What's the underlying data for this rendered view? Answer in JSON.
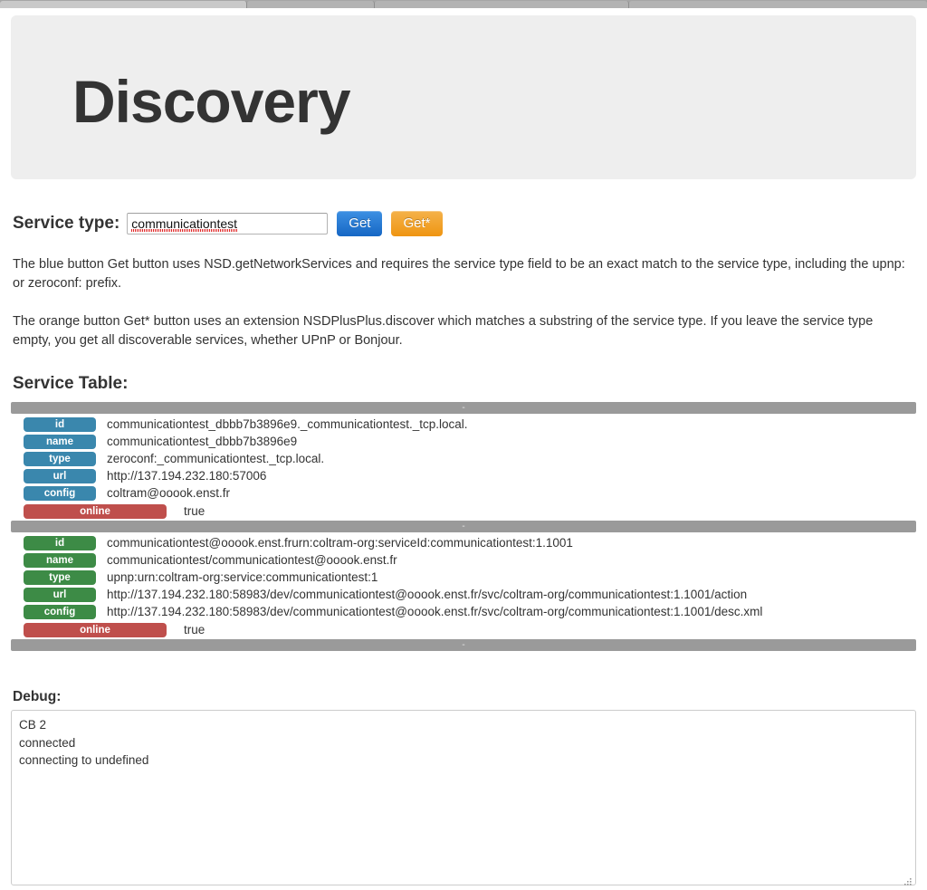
{
  "browser": {
    "tabs": [
      {
        "name": "tab-1",
        "active": true
      },
      {
        "name": "tab-2",
        "active": false
      },
      {
        "name": "tab-3",
        "active": false
      },
      {
        "name": "tab-4",
        "active": false
      }
    ]
  },
  "header": {
    "title": "Discovery"
  },
  "form": {
    "label": "Service type:",
    "input_value": "communicationtest",
    "input_placeholder": "",
    "get_label": "Get",
    "get_star_label": "Get*"
  },
  "descriptions": {
    "blue": "The blue button Get button uses NSD.getNetworkServices and requires the service type field to be an exact match to the service type, including the upnp: or zeroconf: prefix.",
    "orange": "The orange button Get* button uses an extension NSDPlusPlus.discover which matches a substring of the service type. If you leave the service type empty, you get all discoverable services, whether UPnP or Bonjour."
  },
  "service_table": {
    "title": "Service Table:",
    "separator_label": "-",
    "services": [
      {
        "badge_color": "#3a87ad",
        "online_color": "#bf4f4c",
        "fields": [
          {
            "label": "id",
            "value": "communicationtest_dbbb7b3896e9._communicationtest._tcp.local."
          },
          {
            "label": "name",
            "value": "communicationtest_dbbb7b3896e9"
          },
          {
            "label": "type",
            "value": "zeroconf:_communicationtest._tcp.local."
          },
          {
            "label": "url",
            "value": "http://137.194.232.180:57006"
          },
          {
            "label": "config",
            "value": "coltram@ooook.enst.fr"
          }
        ],
        "online": {
          "label": "online",
          "value": "true"
        }
      },
      {
        "badge_color": "#3d8b46",
        "online_color": "#bf4f4c",
        "fields": [
          {
            "label": "id",
            "value": "communicationtest@ooook.enst.frurn:coltram-org:serviceId:communicationtest:1.1001"
          },
          {
            "label": "name",
            "value": "communicationtest/communicationtest@ooook.enst.fr"
          },
          {
            "label": "type",
            "value": "upnp:urn:coltram-org:service:communicationtest:1"
          },
          {
            "label": "url",
            "value": "http://137.194.232.180:58983/dev/communicationtest@ooook.enst.fr/svc/coltram-org/communicationtest:1.1001/action"
          },
          {
            "label": "config",
            "value": "http://137.194.232.180:58983/dev/communicationtest@ooook.enst.fr/svc/coltram-org/communicationtest:1.1001/desc.xml"
          }
        ],
        "online": {
          "label": "online",
          "value": "true"
        }
      }
    ]
  },
  "debug": {
    "title": "Debug:",
    "content": "CB 2\nconnected\nconnecting to undefined"
  },
  "colors": {
    "blue_badge": "#3a87ad",
    "green_badge": "#3d8b46",
    "red_badge": "#bf4f4c",
    "get_button": "#1667c4",
    "get_star_button": "#ef9512",
    "jumbotron_bg": "#eeeeee",
    "separator_bar": "#9a9a9a"
  }
}
